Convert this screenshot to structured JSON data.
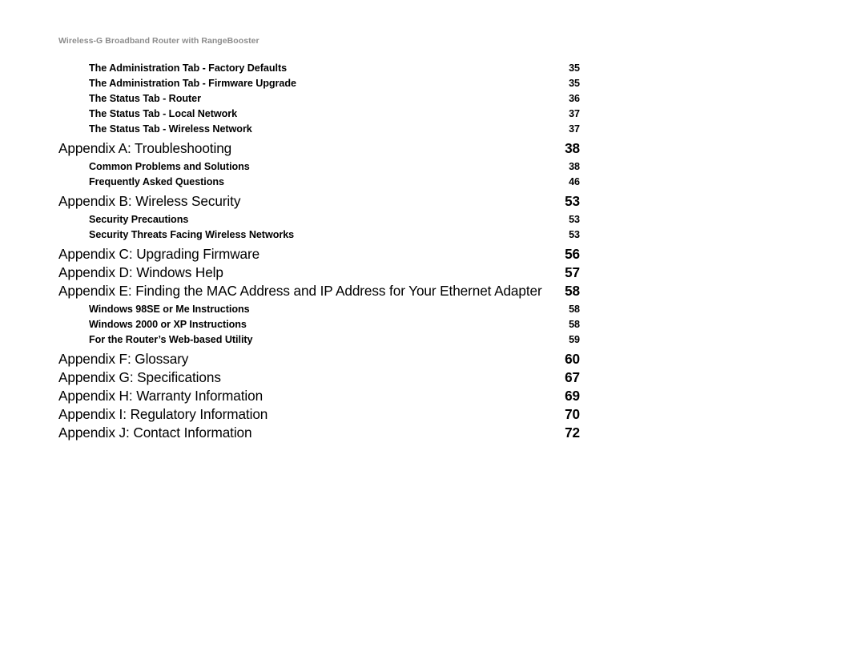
{
  "running_head": "Wireless-G Broadband Router with RangeBooster",
  "toc": {
    "entries": [
      {
        "level": 2,
        "label": "The Administration Tab - Factory Defaults",
        "page": "35"
      },
      {
        "level": 2,
        "label": "The Administration Tab - Firmware Upgrade",
        "page": "35"
      },
      {
        "level": 2,
        "label": "The Status Tab - Router",
        "page": "36"
      },
      {
        "level": 2,
        "label": "The Status Tab - Local Network",
        "page": "37"
      },
      {
        "level": 2,
        "label": "The Status Tab - Wireless Network",
        "page": "37"
      },
      {
        "level": 1,
        "label": "Appendix A: Troubleshooting",
        "page": "38"
      },
      {
        "level": 2,
        "label": "Common Problems and Solutions",
        "page": "38"
      },
      {
        "level": 2,
        "label": "Frequently Asked Questions",
        "page": "46"
      },
      {
        "level": 1,
        "label": "Appendix B: Wireless Security",
        "page": "53"
      },
      {
        "level": 2,
        "label": "Security Precautions",
        "page": "53"
      },
      {
        "level": 2,
        "label": "Security Threats Facing Wireless Networks",
        "page": "53"
      },
      {
        "level": 1,
        "label": "Appendix C: Upgrading Firmware",
        "page": "56"
      },
      {
        "level": 1,
        "label": "Appendix D: Windows Help",
        "page": "57"
      },
      {
        "level": 1,
        "label": "Appendix E: Finding the MAC Address and IP Address for Your Ethernet Adapter",
        "page": "58"
      },
      {
        "level": 2,
        "label": "Windows 98SE or Me Instructions",
        "page": "58"
      },
      {
        "level": 2,
        "label": "Windows 2000 or XP Instructions",
        "page": "58"
      },
      {
        "level": 2,
        "label": "For the Router’s Web-based Utility",
        "page": "59"
      },
      {
        "level": 1,
        "label": "Appendix F: Glossary",
        "page": "60"
      },
      {
        "level": 1,
        "label": "Appendix G: Specifications",
        "page": "67"
      },
      {
        "level": 1,
        "label": "Appendix H: Warranty Information",
        "page": "69"
      },
      {
        "level": 1,
        "label": "Appendix I: Regulatory Information",
        "page": "70"
      },
      {
        "level": 1,
        "label": "Appendix J: Contact Information",
        "page": "72"
      }
    ]
  },
  "colors": {
    "page_background": "#ffffff",
    "body_text": "#000000",
    "running_head_text": "#8c8c8c"
  }
}
